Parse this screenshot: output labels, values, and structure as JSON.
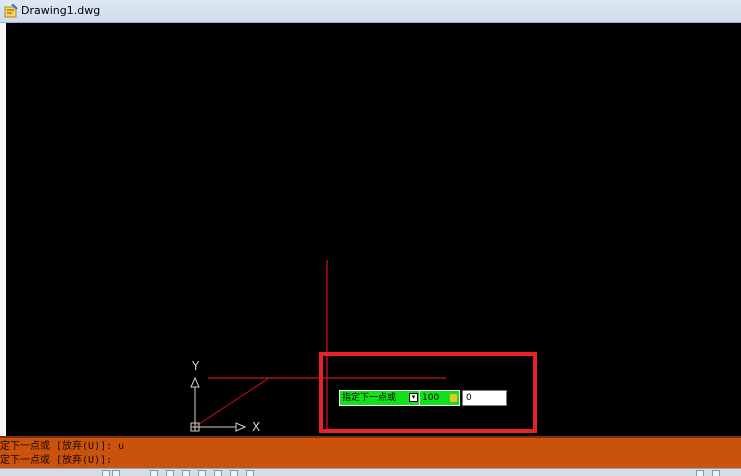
{
  "window": {
    "title": "Drawing1.dwg"
  },
  "ucs": {
    "x_label": "X",
    "y_label": "Y"
  },
  "dynamic_input": {
    "prompt": "指定下一点或",
    "length_value": "100",
    "angle_value": "0"
  },
  "command_history": [
    "定下一点或 [放弃(U)]: u",
    "定下一点或 [放弃(U)]:"
  ],
  "colors": {
    "canvas": "#000000",
    "crosshair": "#ff1a1a",
    "highlight": "#e8212a",
    "dynamic_input_bg": "#11e31a",
    "command_area": "#c9530d"
  }
}
